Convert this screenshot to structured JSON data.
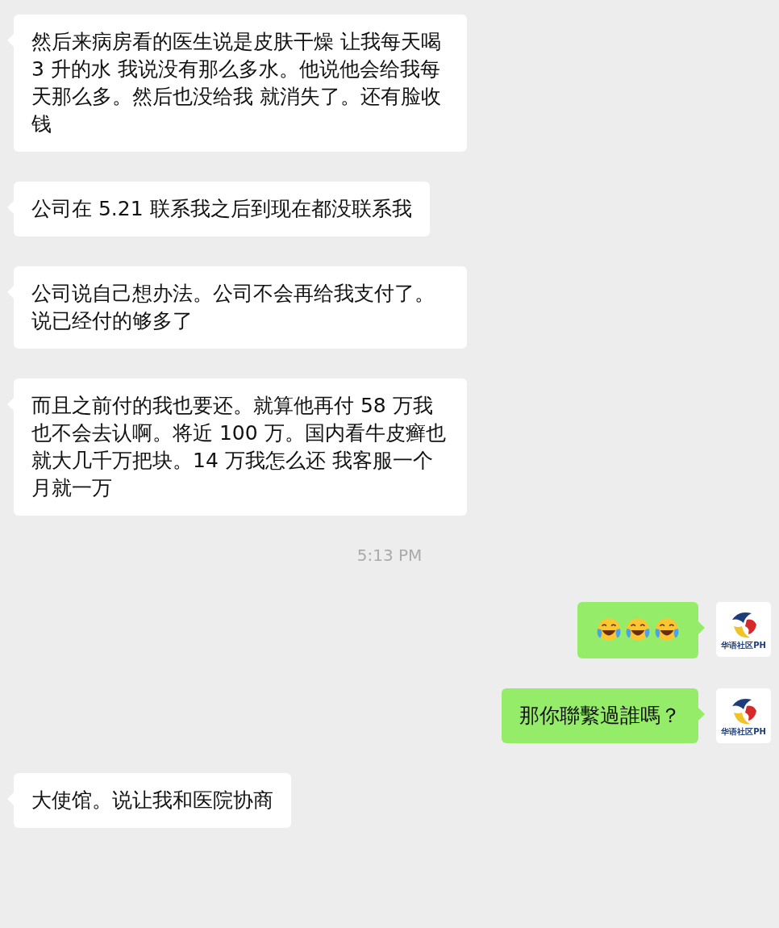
{
  "messages": [
    {
      "kind": "received",
      "text": "然后来病房看的医生说是皮肤干燥 让我每天喝 3 升的水 我说没有那么多水。他说他会给我每天那么多。然后也没给我 就消失了。还有脸收钱"
    },
    {
      "kind": "received",
      "text": "公司在 5.21 联系我之后到现在都没联系我"
    },
    {
      "kind": "received",
      "text": "公司说自己想办法。公司不会再给我支付了。说已经付的够多了"
    },
    {
      "kind": "received",
      "text": "而且之前付的我也要还。就算他再付 58 万我也不会去认啊。将近 100 万。国内看牛皮癣也就大几千万把块。14 万我怎么还 我客服一个月就一万"
    },
    {
      "kind": "time",
      "text": "5:13 PM"
    },
    {
      "kind": "sent-emoji",
      "avatar_label": "华语社区PH",
      "emojis": [
        {
          "kind": "laugh-cry"
        },
        {
          "kind": "laugh-cry"
        },
        {
          "kind": "laugh-cry"
        }
      ]
    },
    {
      "kind": "sent",
      "avatar_label": "华语社区PH",
      "text": "那你聯繫過誰嗎？"
    },
    {
      "kind": "received",
      "text": "大使馆。说让我和医院协商"
    }
  ]
}
